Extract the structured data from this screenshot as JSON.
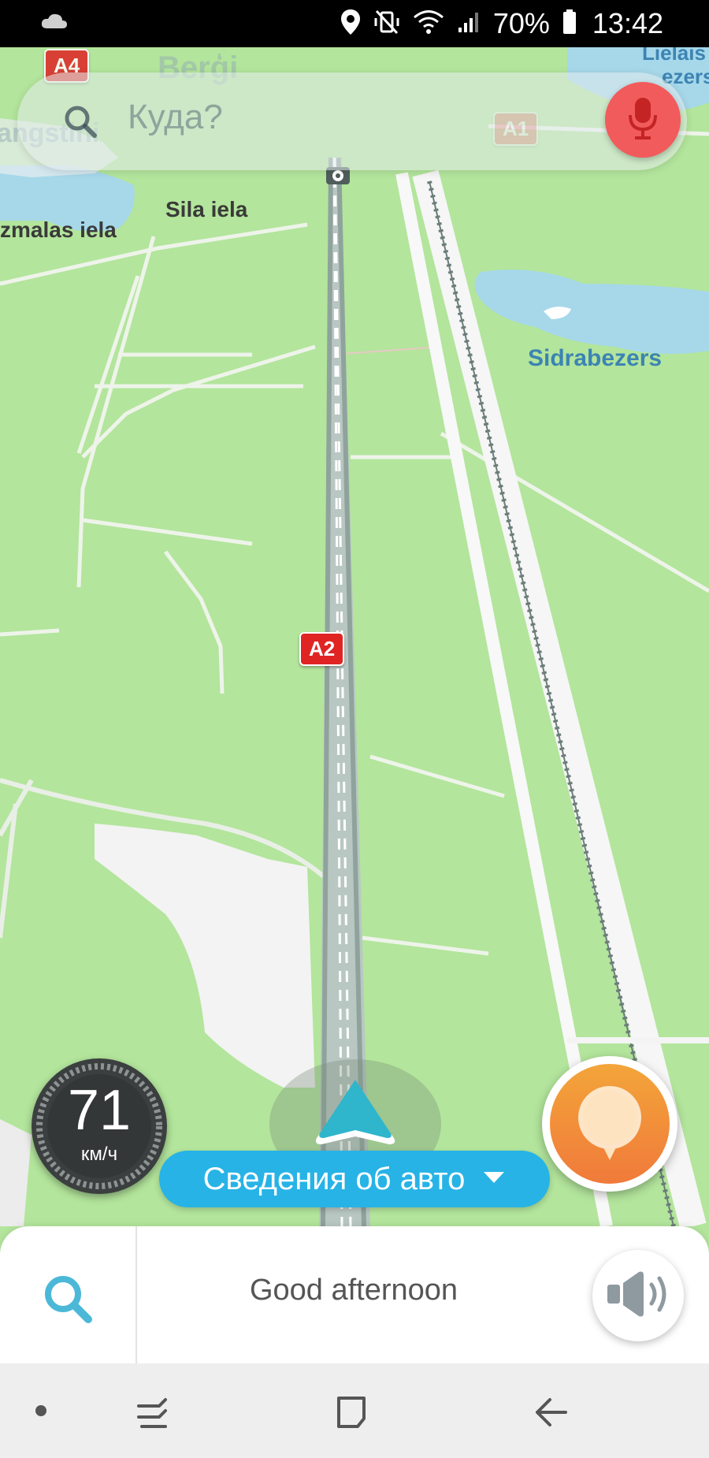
{
  "status_bar": {
    "battery_text": "70%",
    "time": "13:42",
    "icons": [
      "cloud-icon",
      "location-icon",
      "mute-vibrate-icon",
      "wifi-icon",
      "signal-icon",
      "battery-icon"
    ]
  },
  "search": {
    "placeholder": "Куда?"
  },
  "map": {
    "labels": {
      "bergi": "Berģi",
      "sila_iela": "Sila iela",
      "mezmalas_iela": "zmalas iela",
      "sidrabezers": "Sidrabezers",
      "lielais": "Lielais",
      "ezers": "ezers",
      "angstini": "angstini"
    },
    "shields": {
      "a4": "A4",
      "a1": "A1",
      "a2": "A2"
    },
    "colors": {
      "land": "#b3e59c",
      "water": "#a6d8ea",
      "road": "#ffffff",
      "highway": "#9eb4ae"
    }
  },
  "speed": {
    "value": "71",
    "unit": "км/ч"
  },
  "car_info": {
    "label": "Сведения об авто"
  },
  "bottom": {
    "greeting": "Good afternoon"
  },
  "colors": {
    "accent_blue": "#27b3e6",
    "mic_red": "#f25b5b",
    "report_orange": "#f07a3a",
    "search_icon_blue": "#4cb8d8"
  }
}
